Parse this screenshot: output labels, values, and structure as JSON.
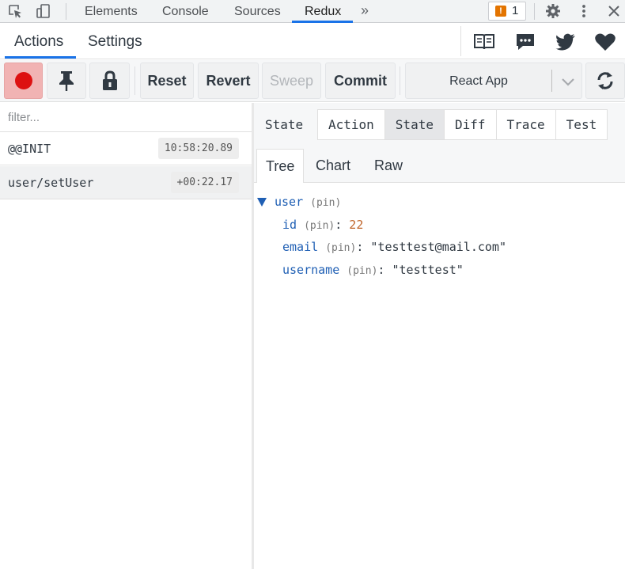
{
  "devtools": {
    "tabs": [
      "Elements",
      "Console",
      "Sources",
      "Redux"
    ],
    "active_tab": "Redux",
    "more_icon": "double-chevron-right-icon",
    "issues_count": "1",
    "accent": "#1a73e8"
  },
  "redux_tabs": {
    "items": [
      "Actions",
      "Settings"
    ],
    "active": "Actions"
  },
  "toolbar": {
    "record_color": "#dd1111",
    "reset": "Reset",
    "revert": "Revert",
    "sweep": "Sweep",
    "commit": "Commit",
    "instance": "React App"
  },
  "filter": {
    "placeholder": "filter..."
  },
  "actions": [
    {
      "name": "@@INIT",
      "time": "10:58:20.89",
      "selected": false
    },
    {
      "name": "user/setUser",
      "time": "+00:22.17",
      "selected": true
    }
  ],
  "monitor": {
    "title": "State",
    "tabs": [
      "Action",
      "State",
      "Diff",
      "Trace",
      "Test"
    ],
    "active_tab": "State",
    "views": [
      "Tree",
      "Chart",
      "Raw"
    ],
    "active_view": "Tree"
  },
  "tree": {
    "root_key": "user",
    "pin": "(pin)",
    "colon": ":",
    "fields": [
      {
        "key": "id",
        "value": "22",
        "type": "number"
      },
      {
        "key": "email",
        "value": "\"testtest@mail.com\"",
        "type": "string"
      },
      {
        "key": "username",
        "value": "\"testtest\"",
        "type": "string"
      }
    ]
  }
}
